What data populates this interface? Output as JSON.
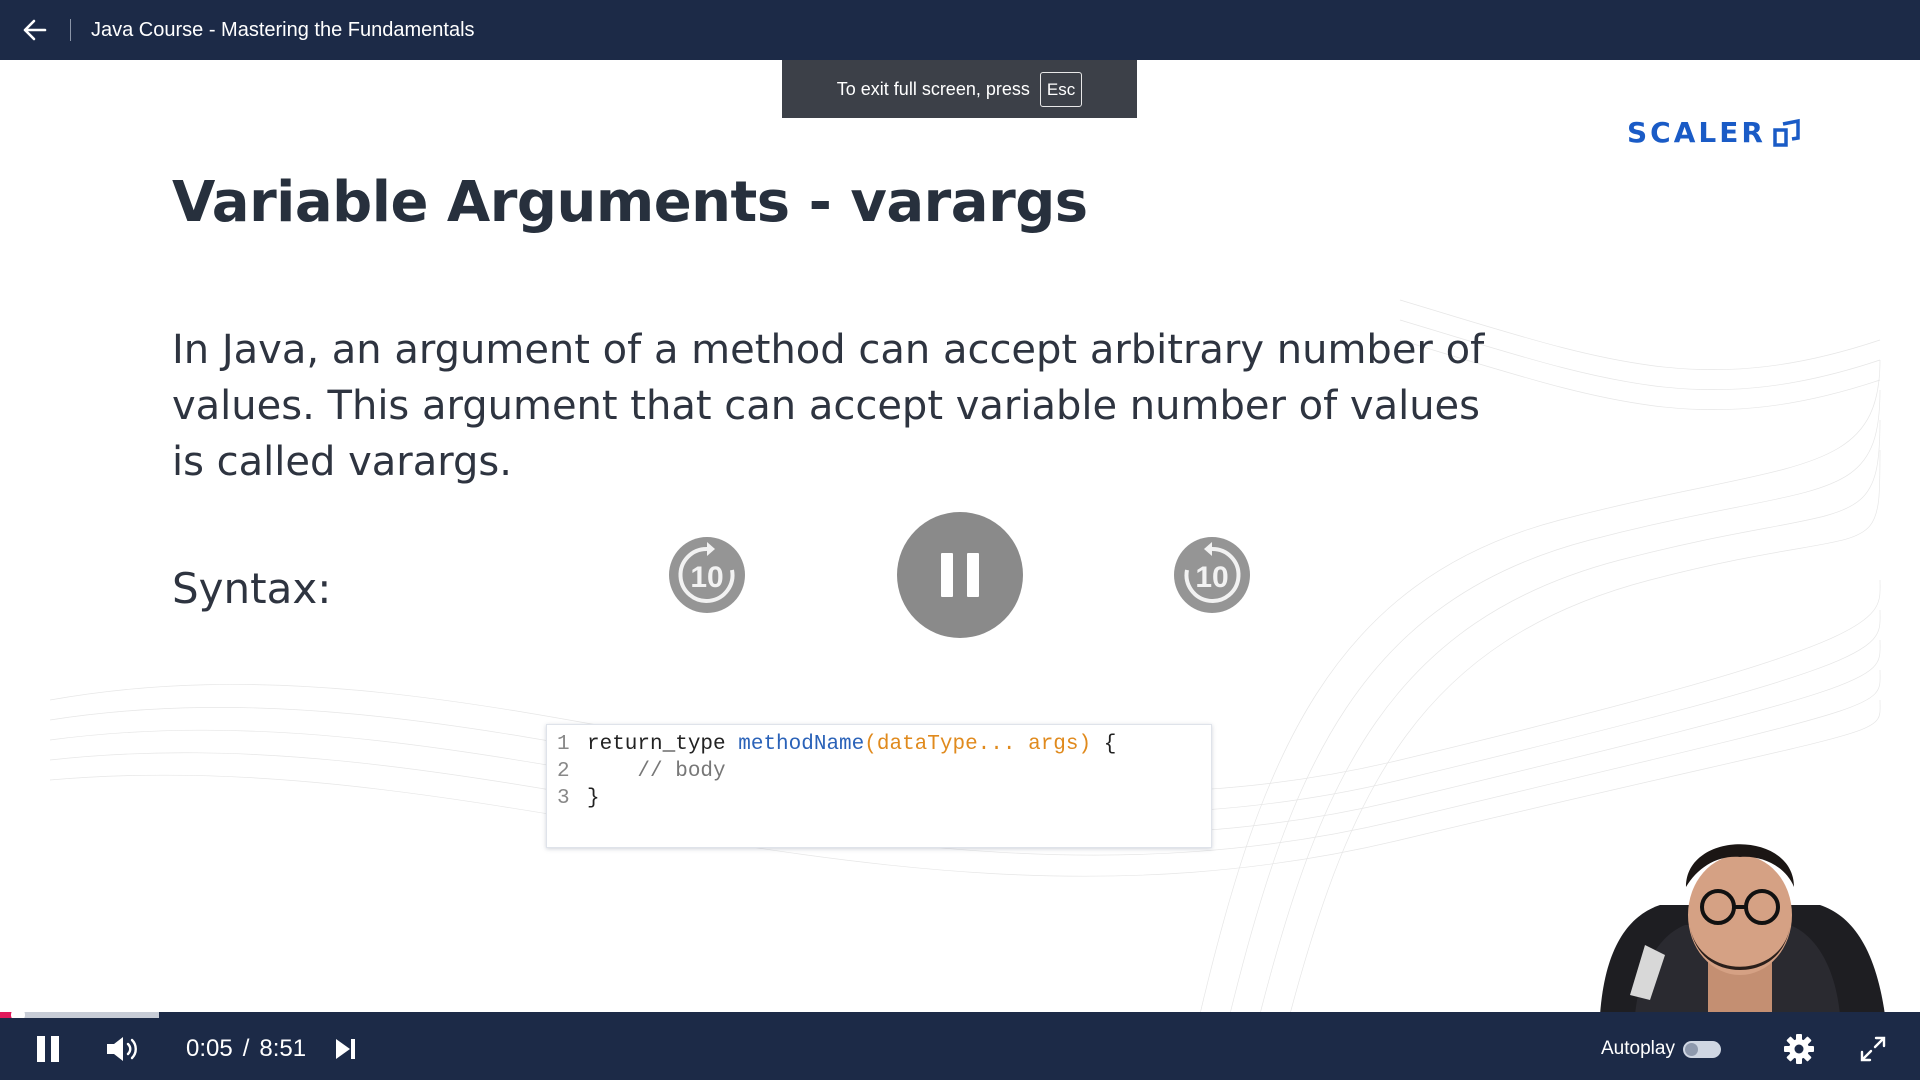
{
  "header": {
    "course_title": "Java Course - Mastering the Fundamentals"
  },
  "fullscreen_notice": {
    "text": "To exit full screen, press",
    "key": "Esc"
  },
  "slide": {
    "logo_text": "SCALER",
    "title": "Variable Arguments - varargs",
    "body": "In Java, an argument of a method can accept arbitrary number of values. This argument that can accept variable number of values is called varargs.",
    "syntax_label": "Syntax:",
    "code": {
      "line_numbers": [
        "1",
        "2",
        "3"
      ],
      "line1": {
        "return_type": "return_type ",
        "method": "methodName",
        "params": "(dataType... args)",
        "brace": " {"
      },
      "line2": "    // body",
      "line3": "}"
    }
  },
  "overlay": {
    "rewind_seconds": "10",
    "forward_seconds": "10"
  },
  "player": {
    "current_time": "0:05",
    "separator": "/",
    "duration": "8:51",
    "played_fraction": 0.0094,
    "buffered_fraction": 0.083,
    "autoplay_label": "Autoplay",
    "autoplay_on": false
  },
  "colors": {
    "bar_bg": "#1c2a47",
    "progress_played": "#e0185a",
    "logo_blue": "#1a5bc6"
  }
}
